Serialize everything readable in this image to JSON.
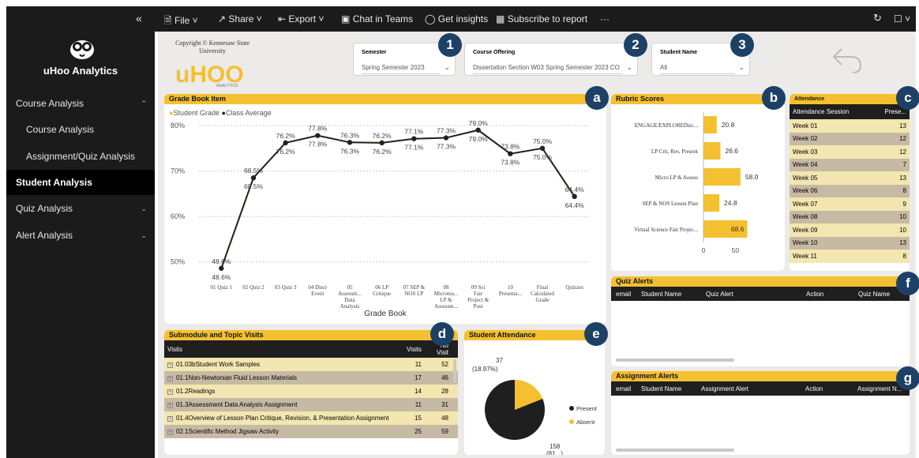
{
  "topbar": {
    "collapse": "«",
    "file": "File",
    "share": "Share",
    "export": "Export",
    "chat": "Chat in Teams",
    "insights": "Get insights",
    "subscribe": "Subscribe to report",
    "more": "···"
  },
  "sidebar": {
    "brand": "uHoo Analytics",
    "items": [
      {
        "label": "Course Analysis",
        "expanded": true
      },
      {
        "label": "Course Analysis"
      },
      {
        "label": "Assignment/Quiz Analysis"
      },
      {
        "label": "Student Analysis",
        "active": true
      },
      {
        "label": "Quiz Analysis"
      },
      {
        "label": "Alert Analysis"
      }
    ]
  },
  "header": {
    "copyright": "Copyright © Kennesaw State University",
    "logo_word": "uHOO",
    "logo_sub": "ANALYTICS"
  },
  "slicers": {
    "semester_title": "Semester",
    "semester_value": "Spring Semester 2023",
    "course_title": "Course Offering",
    "course_value": "Dissertation Section W03 Spring Semester 2023 CO",
    "student_title": "Student Name",
    "student_value": "All"
  },
  "badges": [
    "1",
    "2",
    "3",
    "a",
    "b",
    "c",
    "d",
    "e",
    "f",
    "g"
  ],
  "gradebook": {
    "title": "Grade Book Item",
    "legend_student": "Student Grade",
    "legend_class": "Class Average",
    "xlabel": "Grade Book"
  },
  "chart_data": [
    {
      "type": "line",
      "title": "Grade Book Item",
      "xlabel": "Grade Book",
      "ylabel": "",
      "ylim": [
        47,
        80
      ],
      "yticks": [
        "80%",
        "70%",
        "60%",
        "50%"
      ],
      "categories": [
        "01 Quiz 1",
        "02 Quiz 2",
        "03 Quiz 3",
        "04 Discr Event",
        "05 Assessm... Data Analysis",
        "06 LP Critique",
        "07 SEP & NOS LP",
        "08 Microtea... LP & Assessm...",
        "09 Sci Fair Project & Post",
        "10 Presenta...",
        "Final Calculated Grade",
        "Quizzes"
      ],
      "series": [
        {
          "name": "Student Grade",
          "color": "#f5c02f",
          "values": [
            48.6,
            68.5,
            76.2,
            77.8,
            76.3,
            76.2,
            77.1,
            77.3,
            79.0,
            73.8,
            75.0,
            64.4
          ]
        },
        {
          "name": "Class Average",
          "color": "#222222",
          "values": [
            48.6,
            68.5,
            76.2,
            77.8,
            76.3,
            76.2,
            77.1,
            77.3,
            79.0,
            73.8,
            75.0,
            64.4
          ]
        }
      ],
      "labels_top": [
        "48.6%",
        "68.5%",
        "76.2%",
        "77.8%",
        "76.3%",
        "76.2%",
        "77.1%",
        "77.3%",
        "79.0%",
        "73.8%",
        "75.0%",
        "64.4%"
      ],
      "labels_bottom": [
        "48.6%",
        "68.5%",
        "76.2%",
        "77.8%",
        "76.3%",
        "76.2%",
        "77.1%",
        "77.3%",
        "79.0%",
        "73.8%",
        "75.0%",
        "64.4%"
      ],
      "grid": true,
      "legend": "top-left"
    },
    {
      "type": "bar",
      "title": "Rubric Scores",
      "categories": [
        "ENGAGE/EXPLOREDisc...",
        "LP Crit, Rev, Present",
        "Micro LP & Assess",
        "SEP & NOS Lesson Plan",
        "Virtual Science Fair Projec..."
      ],
      "values": [
        20.8,
        26.6,
        58.0,
        24.8,
        68.6
      ],
      "value_labels": [
        "20.8",
        "26.6",
        "58.0",
        "24.8",
        "68.6"
      ],
      "xticks": [
        "0",
        "50"
      ],
      "xlim": [
        0,
        78
      ],
      "color": "#f5c02f"
    },
    {
      "type": "pie",
      "title": "Student Attendance",
      "slices": [
        {
          "name": "Present",
          "value": 158,
          "color": "#1f1f1f"
        },
        {
          "name": "Absent",
          "value": 37,
          "color": "#f5c02f"
        }
      ],
      "label_absent_1": "37",
      "label_absent_2": "(18.97%)",
      "label_present_1": "158",
      "label_present_2": "(81...)",
      "legend": "right"
    }
  ],
  "attendance": {
    "title": "Attendance",
    "col1": "Attendance Session",
    "col2": "Prese...",
    "rows": [
      [
        "Week 01",
        "13"
      ],
      [
        "Week 02",
        "12"
      ],
      [
        "Week 03",
        "12"
      ],
      [
        "Week 04",
        "7"
      ],
      [
        "Week 05",
        "13"
      ],
      [
        "Week 06",
        "8"
      ],
      [
        "Week 07",
        "9"
      ],
      [
        "Week 08",
        "10"
      ],
      [
        "Week 09",
        "10"
      ],
      [
        "Week 10",
        "13"
      ],
      [
        "Week 11",
        "8"
      ]
    ]
  },
  "visits": {
    "title": "Submodule and Topic Visits",
    "col1": "Visits",
    "col2": "Visits",
    "col3": "No Visit",
    "rows": [
      [
        "01.03bStudent Work Samples",
        "11",
        "52"
      ],
      [
        "01.1Non-Newtonian Fluid Lesson Materials",
        "17",
        "46"
      ],
      [
        "01.2Readings",
        "14",
        "28"
      ],
      [
        "01.3Assessment Data Analysis Assignment",
        "11",
        "31"
      ],
      [
        "01.4Overview of Lesson Plan Critique, Revision, & Presentation Assignment",
        "15",
        "48"
      ],
      [
        "02.1Scientific Method Jigsaw Activity",
        "25",
        "59"
      ]
    ]
  },
  "quiz_alerts": {
    "title": "Quiz Alerts",
    "cols": [
      "email",
      "Student Name",
      "Quiz Alert",
      "Action",
      "Quiz Name"
    ]
  },
  "assign_alerts": {
    "title": "Assignment Alerts",
    "cols": [
      "email",
      "Student Name",
      "Assignment Alert",
      "Action",
      "Assignment N..."
    ]
  },
  "colors": {
    "accent": "#f5c02f",
    "dark": "#1b1b1b",
    "badge": "#1d4067"
  }
}
